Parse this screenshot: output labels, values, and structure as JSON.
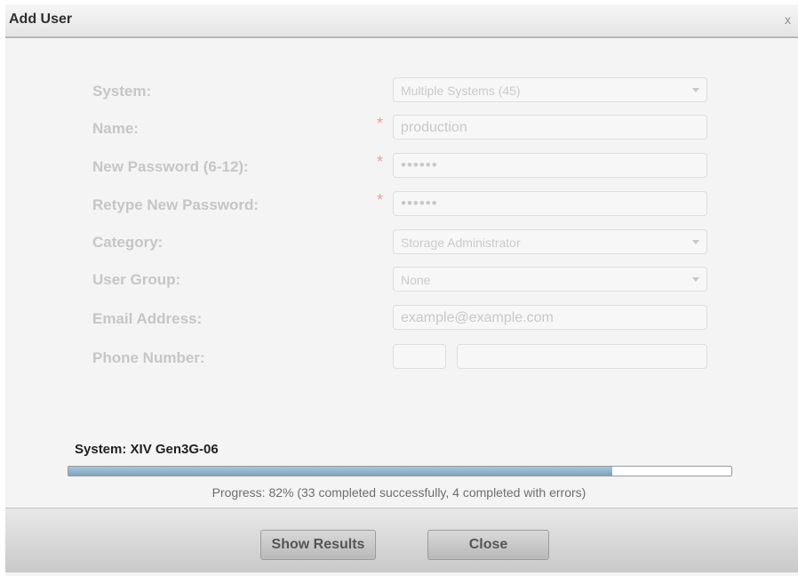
{
  "dialog": {
    "title": "Add User",
    "close_label": "x"
  },
  "form": {
    "fields": [
      {
        "label": "System:",
        "value": "Multiple Systems (45)",
        "required": false,
        "type": "select"
      },
      {
        "label": "Name:",
        "value": "production",
        "required": true,
        "type": "text"
      },
      {
        "label": "New Password (6-12):",
        "value": "••••••",
        "required": true,
        "type": "password"
      },
      {
        "label": "Retype New Password:",
        "value": "••••••",
        "required": true,
        "type": "password"
      },
      {
        "label": "Category:",
        "value": "Storage Administrator",
        "required": false,
        "type": "select"
      },
      {
        "label": "User Group:",
        "value": "None",
        "required": false,
        "type": "select"
      },
      {
        "label": "Email Address:",
        "value": "example@example.com",
        "required": false,
        "type": "text"
      },
      {
        "label": "Phone Number:",
        "value": "",
        "required": false,
        "type": "phone"
      }
    ],
    "required_marker": "*"
  },
  "progress": {
    "system_label": "System: XIV Gen3G-06",
    "percent": 82,
    "text": "Progress: 82% (33 completed successfully, 4 completed with errors)"
  },
  "footer": {
    "show_results_label": "Show Results",
    "close_label": "Close"
  }
}
